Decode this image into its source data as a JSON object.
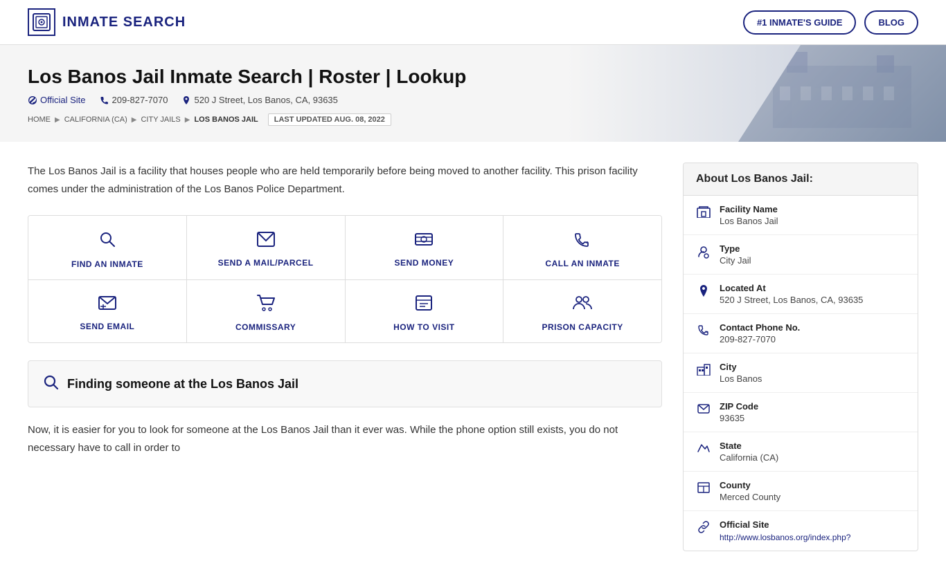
{
  "header": {
    "logo_text": "INMATE SEARCH",
    "btn_guide": "#1 INMATE'S GUIDE",
    "btn_blog": "BLOG"
  },
  "hero": {
    "title": "Los Banos Jail Inmate Search | Roster | Lookup",
    "official_site_label": "Official Site",
    "phone": "209-827-7070",
    "address": "520 J Street, Los Banos, CA, 93635",
    "updated": "LAST UPDATED AUG. 08, 2022"
  },
  "breadcrumb": {
    "home": "HOME",
    "california": "CALIFORNIA (CA)",
    "city_jails": "CITY JAILS",
    "current": "LOS BANOS JAIL"
  },
  "description": "The Los Banos Jail is a facility that houses people who are held temporarily before being moved to another facility. This prison facility comes under the administration of the Los Banos Police Department.",
  "actions": {
    "row1": [
      {
        "label": "FIND AN INMATE",
        "icon": "🔍"
      },
      {
        "label": "SEND A MAIL/PARCEL",
        "icon": "✉"
      },
      {
        "label": "SEND MONEY",
        "icon": "📷"
      },
      {
        "label": "CALL AN INMATE",
        "icon": "📞"
      }
    ],
    "row2": [
      {
        "label": "SEND EMAIL",
        "icon": "💬"
      },
      {
        "label": "COMMISSARY",
        "icon": "🛒"
      },
      {
        "label": "HOW TO VISIT",
        "icon": "📋"
      },
      {
        "label": "PRISON CAPACITY",
        "icon": "👥"
      }
    ]
  },
  "finding_section": {
    "heading": "Finding someone at the Los Banos Jail"
  },
  "body_text": "Now, it is easier for you to look for someone at the Los Banos Jail than it ever was. While the phone option still exists, you do not necessary have to call in order to",
  "sidebar": {
    "header": "About Los Banos Jail:",
    "rows": [
      {
        "icon": "🏢",
        "label": "Facility Name",
        "value": "Los Banos Jail",
        "link": null
      },
      {
        "icon": "👤",
        "label": "Type",
        "value": "City Jail",
        "link": null
      },
      {
        "icon": "📍",
        "label": "Located At",
        "value": "520 J Street, Los Banos, CA, 93635",
        "link": null
      },
      {
        "icon": "📞",
        "label": "Contact Phone No.",
        "value": "209-827-7070",
        "link": null
      },
      {
        "icon": "🏙",
        "label": "City",
        "value": "Los Banos",
        "link": null
      },
      {
        "icon": "✉",
        "label": "ZIP Code",
        "value": "93635",
        "link": null
      },
      {
        "icon": "🗺",
        "label": "State",
        "value": "California (CA)",
        "link": null
      },
      {
        "icon": "🏛",
        "label": "County",
        "value": "Merced County",
        "link": null
      },
      {
        "icon": "🔗",
        "label": "Official Site",
        "value": null,
        "link": "http://www.losbanos.org/index.php?"
      }
    ]
  }
}
